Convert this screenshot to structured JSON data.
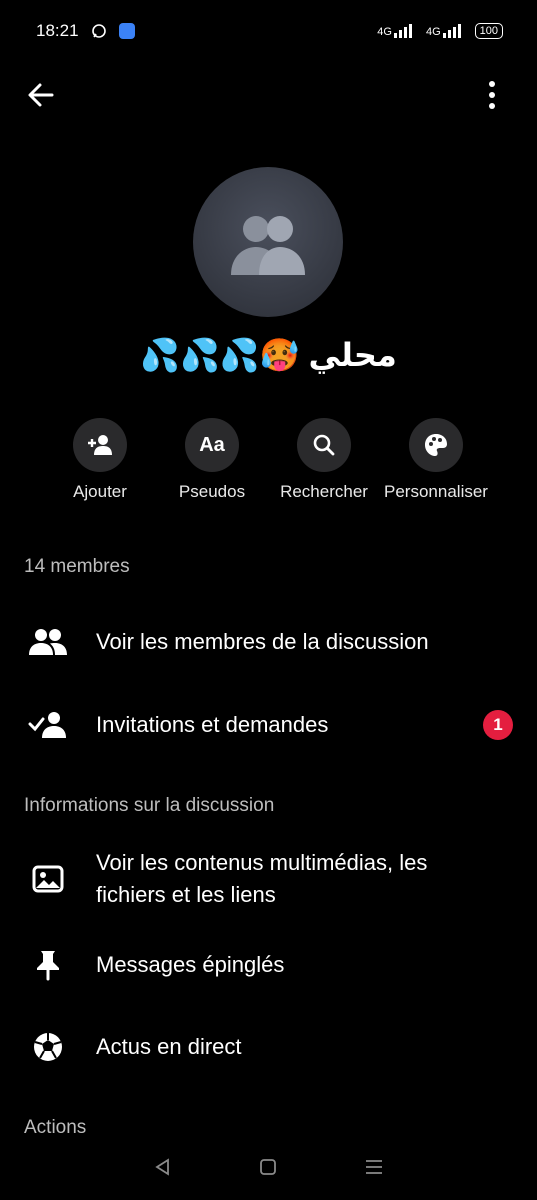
{
  "status": {
    "time": "18:21",
    "network1": "4G",
    "network2": "4G",
    "battery": "100"
  },
  "group": {
    "name": "محلي 🥵💦💦💦"
  },
  "actions": [
    {
      "label": "Ajouter"
    },
    {
      "label": "Pseudos",
      "glyph": "Aa"
    },
    {
      "label": "Rechercher"
    },
    {
      "label": "Personnaliser"
    }
  ],
  "members": {
    "count_label": "14 membres",
    "see_members": "Voir les membres de la discussion",
    "invitations": "Invitations et demandes",
    "invitations_badge": "1"
  },
  "info": {
    "title": "Informations sur la discussion",
    "media": "Voir les contenus multimédias, les fichiers et les liens",
    "pinned": "Messages épinglés",
    "live": "Actus en direct"
  },
  "actions_section": {
    "title": "Actions"
  },
  "colors": {
    "background": "#000000",
    "button_bg": "#2a2a2c",
    "badge": "#e41e3f"
  }
}
